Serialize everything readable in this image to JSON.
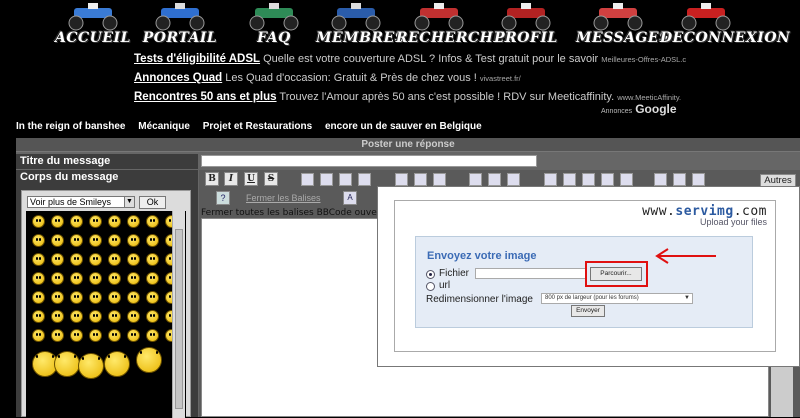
{
  "nav": [
    {
      "label": "ACCUEIL",
      "color": "#3a7bd5"
    },
    {
      "label": "PORTAIL",
      "color": "#2f6fd0"
    },
    {
      "label": "FAQ",
      "color": "#2e8b57"
    },
    {
      "label": "MEMBRES",
      "color": "#2a5caa"
    },
    {
      "label": "RECHERCHER",
      "color": "#c03030"
    },
    {
      "label": "PROFIL",
      "color": "#b22222"
    },
    {
      "label": "MESSAGES",
      "color": "#d04040"
    },
    {
      "label": "DECONNEXION",
      "color": "#c82020"
    }
  ],
  "ads": [
    {
      "title": "Tests d'éligibilité ADSL",
      "desc": "Quelle est votre couverture ADSL ? Infos & Test gratuit pour le savoir",
      "url": "Meilleures-Offres-ADSL.c"
    },
    {
      "title": "Annonces Quad",
      "desc": "Les Quad d'occasion: Gratuit & Près de chez vous !",
      "url": "vivastreet.fr/"
    },
    {
      "title": "Rencontres 50 ans et plus",
      "desc": "Trouvez l'Amour après 50 ans c'est possible ! RDV sur Meeticaffinity.",
      "url": "www.MeeticAffinity."
    }
  ],
  "ads_footer": {
    "label": "Annonces",
    "brand": "Google"
  },
  "breadcrumb": [
    "In the reign of banshee",
    "Mécanique",
    "Projet et Restaurations",
    "encore un de sauver en Belgique"
  ],
  "form": {
    "header": "Poster une réponse",
    "subject_label": "Titre du message",
    "body_label": "Corps du message",
    "autres_label": "Autres",
    "close_tags_label": "Fermer les Balises",
    "hint": "Fermer toutes les balises BBCode ouverte",
    "toolbar_buttons": [
      "B",
      "I",
      "U",
      "S"
    ]
  },
  "smileys": {
    "select_value": "Voir plus de Smileys",
    "ok_label": "Ok"
  },
  "upload": {
    "logo_prefix": "www.",
    "logo_domain": "servimg",
    "logo_suffix": ".com",
    "tagline": "Upload your files",
    "title": "Envoyez votre image",
    "file_label": "Fichier",
    "url_label": "url",
    "browse_label": "Parcourir...",
    "resize_label": "Redimensionner l'image",
    "resize_value": "800 px de largeur (pour les forums)",
    "send_label": "Envoyer"
  }
}
